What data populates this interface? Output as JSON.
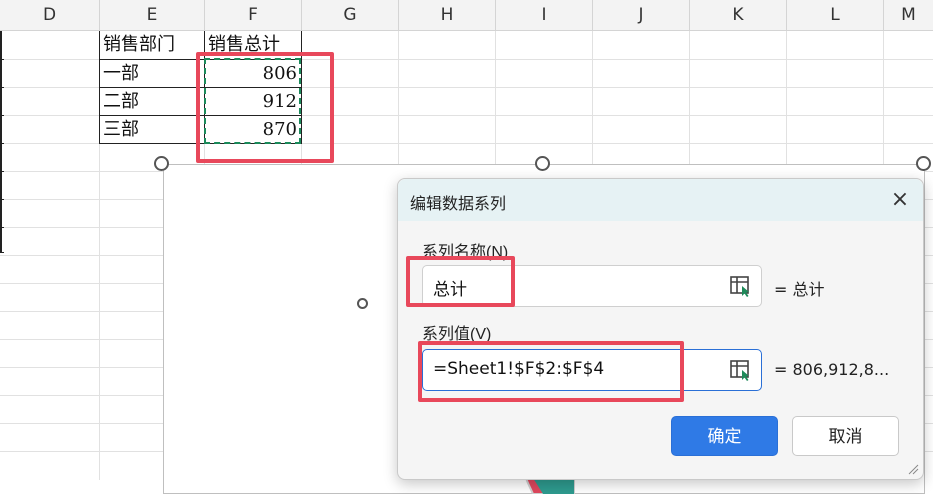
{
  "columns": [
    "D",
    "E",
    "F",
    "G",
    "H",
    "I",
    "J",
    "K",
    "L",
    "M"
  ],
  "sheet": {
    "header_row": {
      "e": "销售部门",
      "f": "销售总计"
    },
    "rows": [
      {
        "dept": "一部",
        "total": "806"
      },
      {
        "dept": "二部",
        "total": "912"
      },
      {
        "dept": "三部",
        "total": "870"
      }
    ]
  },
  "dialog": {
    "title": "编辑数据系列",
    "series_name_label": "系列名称(N)",
    "series_name_value": "总计",
    "series_name_result": "= 总计",
    "series_values_label": "系列值(V)",
    "series_values_value": "=Sheet1!$F$2:$F$4",
    "series_values_result": "= 806,912,8...",
    "ok_label": "确定",
    "cancel_label": "取消",
    "close_icon": "×"
  },
  "chart_colors": {
    "navy": "#2b3f86",
    "red": "#e0485e",
    "teal": "#2e9b8f"
  },
  "highlight_color": "#e8485b"
}
